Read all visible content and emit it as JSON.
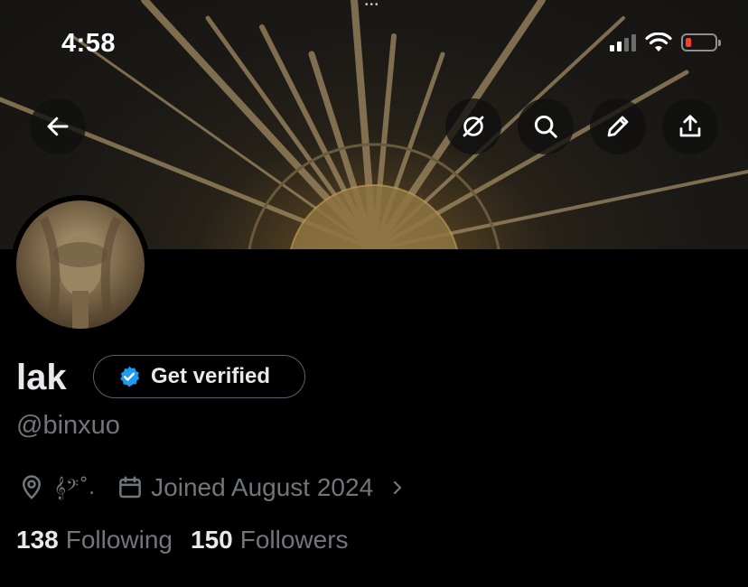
{
  "status_bar": {
    "time": "4:58",
    "dots": "•••"
  },
  "profile": {
    "name": "lak",
    "verify_label": "Get verified",
    "handle": "@binxuo",
    "location": "𝄞𝄢˚.",
    "joined": "Joined August 2024",
    "following_count": "138",
    "following_label": "Following",
    "followers_count": "150",
    "followers_label": "Followers"
  },
  "icons": {
    "back": "arrow-left-icon",
    "grok": "grok-icon",
    "search": "search-icon",
    "edit": "pencil-icon",
    "share": "share-icon",
    "location": "location-pin-icon",
    "calendar": "calendar-icon",
    "verified": "verified-badge-icon"
  },
  "colors": {
    "verified_blue": "#1d9bf0",
    "muted": "#71767b",
    "battery_low": "#ff3b30"
  }
}
